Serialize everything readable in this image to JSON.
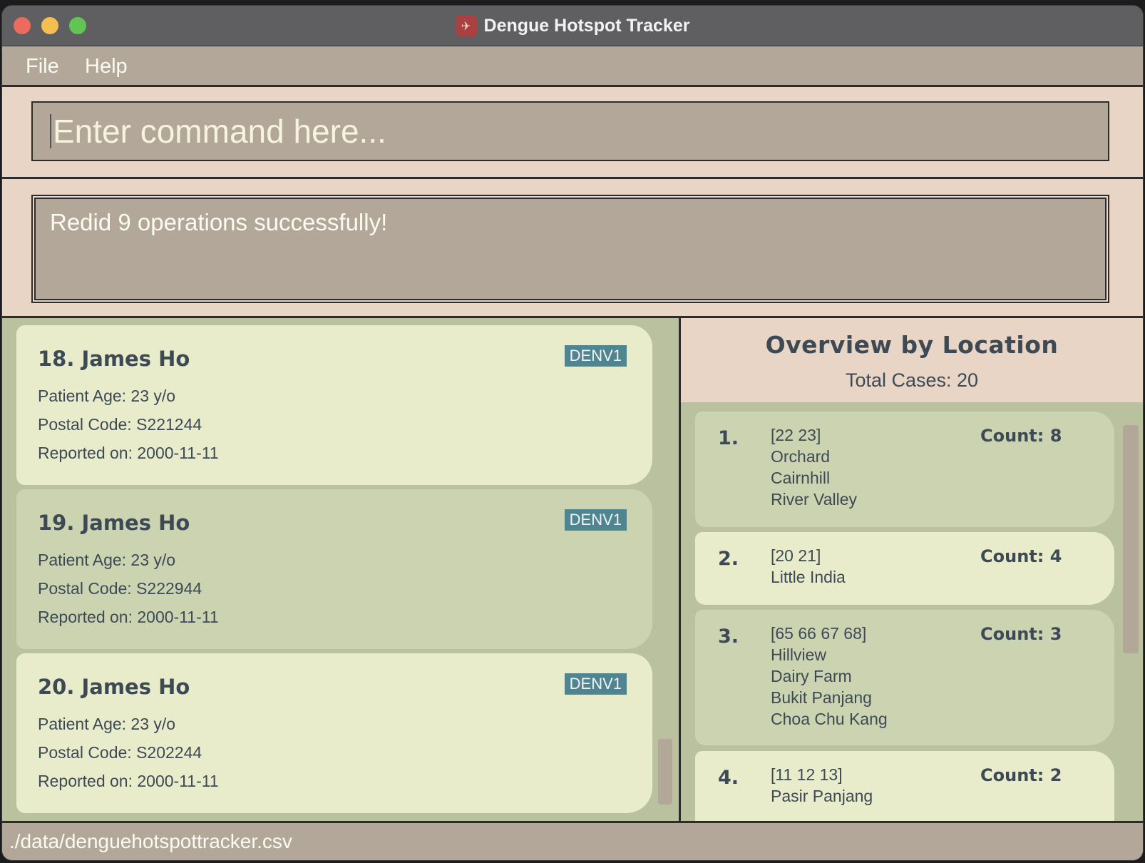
{
  "window": {
    "title": "Dengue Hotspot Tracker"
  },
  "menu": {
    "file": "File",
    "help": "Help"
  },
  "command": {
    "placeholder": "Enter command here..."
  },
  "result": {
    "message": "Redid 9 operations successfully!"
  },
  "cases": [
    {
      "name": "18. James Ho",
      "variant": "DENV1",
      "age": "Patient Age: 23 y/o",
      "postal": "Postal Code: S221244",
      "reported": "Reported on: 2000-11-11"
    },
    {
      "name": "19. James Ho",
      "variant": "DENV1",
      "age": "Patient Age: 23 y/o",
      "postal": "Postal Code: S222944",
      "reported": "Reported on: 2000-11-11"
    },
    {
      "name": "20. James Ho",
      "variant": "DENV1",
      "age": "Patient Age: 23 y/o",
      "postal": "Postal Code: S202244",
      "reported": "Reported on: 2000-11-11"
    }
  ],
  "overview": {
    "title": "Overview by Location",
    "total": "Total Cases: 20",
    "items": [
      {
        "index": "1.",
        "lines": [
          "[22 23]",
          "Orchard",
          "Cairnhill",
          "River Valley"
        ],
        "count": "Count: 8"
      },
      {
        "index": "2.",
        "lines": [
          "[20 21]",
          "Little India"
        ],
        "count": "Count: 4"
      },
      {
        "index": "3.",
        "lines": [
          "[65 66 67 68]",
          "Hillview",
          "Dairy Farm",
          "Bukit Panjang",
          "Choa Chu Kang"
        ],
        "count": "Count: 3"
      },
      {
        "index": "4.",
        "lines": [
          "[11 12 13]",
          "Pasir Panjang"
        ],
        "count": "Count: 2"
      }
    ]
  },
  "status": {
    "path": "./data/denguehotspottracker.csv"
  },
  "colors": {
    "accent_tag": "#4f8591",
    "panel_bg": "#b9c19f",
    "header_bg": "#e8d5c5"
  }
}
